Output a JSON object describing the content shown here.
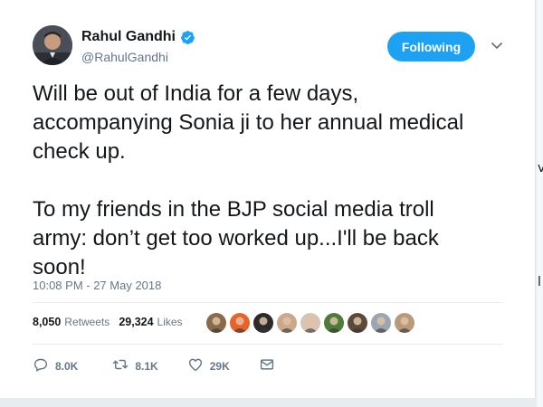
{
  "author": {
    "name": "Rahul Gandhi",
    "handle": "@RahulGandhi",
    "verified": true
  },
  "follow_button": {
    "label": "Following",
    "color": "#1da1f2"
  },
  "tweet": {
    "text": "Will be out of India for a few days,\naccompanying Sonia ji to her annual medical\ncheck up.\n\nTo my friends in the BJP social media troll\narmy: don’t get too worked up...I'll be back\nsoon!",
    "timestamp": "10:08 PM - 27 May 2018"
  },
  "stats": {
    "retweets_count": "8,050",
    "retweets_label": "Retweets",
    "likes_count": "29,324",
    "likes_label": "Likes"
  },
  "liker_avatars": [
    {
      "name": "liker-avatar-1",
      "color": "#8a6a4a"
    },
    {
      "name": "liker-avatar-2",
      "color": "#e8632a"
    },
    {
      "name": "liker-avatar-3",
      "color": "#2b2b2b"
    },
    {
      "name": "liker-avatar-4",
      "color": "#c9a98a"
    },
    {
      "name": "liker-avatar-5",
      "color": "#d9c3b3"
    },
    {
      "name": "liker-avatar-6",
      "color": "#4e7a3a"
    },
    {
      "name": "liker-avatar-7",
      "color": "#5a4a3a"
    },
    {
      "name": "liker-avatar-8",
      "color": "#9aa7b0"
    },
    {
      "name": "liker-avatar-9",
      "color": "#b89a7a"
    }
  ],
  "actions": {
    "reply_count": "8.0K",
    "retweet_count": "8.1K",
    "like_count": "29K"
  },
  "icons": {
    "verified": "verified-badge-icon",
    "caret": "chevron-down-icon",
    "reply": "reply-icon",
    "retweet": "retweet-icon",
    "like": "heart-icon",
    "dm": "envelope-icon"
  }
}
